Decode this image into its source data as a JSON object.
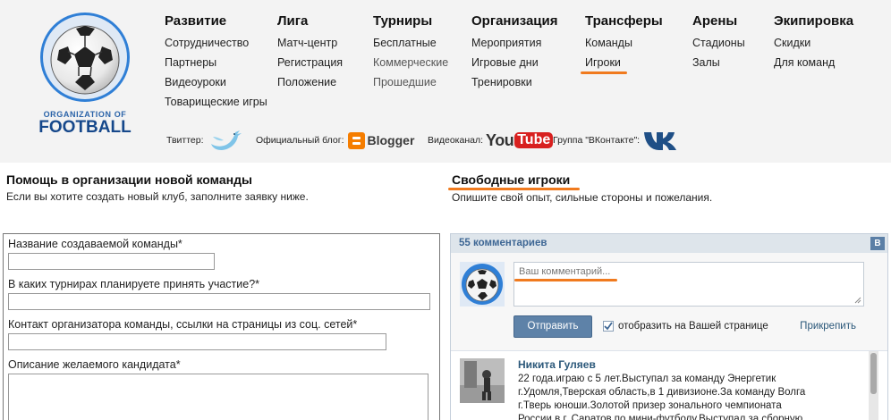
{
  "logo": {
    "line1": "ORGANIZATION OF",
    "line2": "FOOTBALL"
  },
  "nav": [
    {
      "title": "Развитие",
      "items": [
        "Сотрудничество",
        "Партнеры",
        "Видеоуроки",
        "Товарищеские игры"
      ]
    },
    {
      "title": "Лига",
      "items": [
        "Матч-центр",
        "Регистрация",
        "Положение"
      ]
    },
    {
      "title": "Турниры",
      "items": [
        "Бесплатные",
        "Коммерческие",
        "Прошедшие"
      ]
    },
    {
      "title": "Организация",
      "items": [
        "Мероприятия",
        "Игровые дни",
        "Тренировки"
      ]
    },
    {
      "title": "Трансферы",
      "items": [
        "Команды",
        "Игроки"
      ]
    },
    {
      "title": "Арены",
      "items": [
        "Стадионы",
        "Залы"
      ]
    },
    {
      "title": "Экипировка",
      "items": [
        "Скидки",
        "Для команд"
      ]
    }
  ],
  "social": {
    "twitter_label": "Твиттер:",
    "blog_label": "Официальный блог:",
    "blogger_text": "Blogger",
    "video_label": "Видеоканал:",
    "youtube_you": "You",
    "youtube_tube": "Tube",
    "vk_label": "Группа \"ВКонтакте\":"
  },
  "left": {
    "title": "Помощь в организации новой команды",
    "desc": "Если вы хотите создать новый клуб, заполните заявку ниже.",
    "fields": [
      {
        "label": "Название создаваемой команды*"
      },
      {
        "label": "В каких турнирах планируете принять участие?*"
      },
      {
        "label": "Контакт организатора команды, ссылки на страницы из соц. сетей*"
      },
      {
        "label": "Описание желаемого кандидата*"
      }
    ]
  },
  "right": {
    "title": "Свободные игроки",
    "desc": "Опишите свой опыт, сильные стороны и пожелания."
  },
  "vk": {
    "count": "55 комментариев",
    "badge": "В",
    "placeholder": "Ваш комментарий...",
    "send": "Отправить",
    "show_on_page": "отобразить на Вашей странице",
    "attach": "Прикрепить",
    "post": {
      "author": "Никита Гуляев",
      "lines": [
        "22 года.играю с 5 лет.Выступал за команду Энергетик",
        "г.Удомля,Тверская область,в 1 дивизионе.За команду Волга",
        "г.Тверь юноши.Золотой призер зонального чемпионата",
        "России в г. Саратов по мини-футболу.Выступал за сборную"
      ]
    }
  },
  "colors": {
    "accent": "#f07a1e",
    "vk_blue": "#5e82a8",
    "vk_link": "#2b587a",
    "header_bg": "#f3f3f3"
  }
}
